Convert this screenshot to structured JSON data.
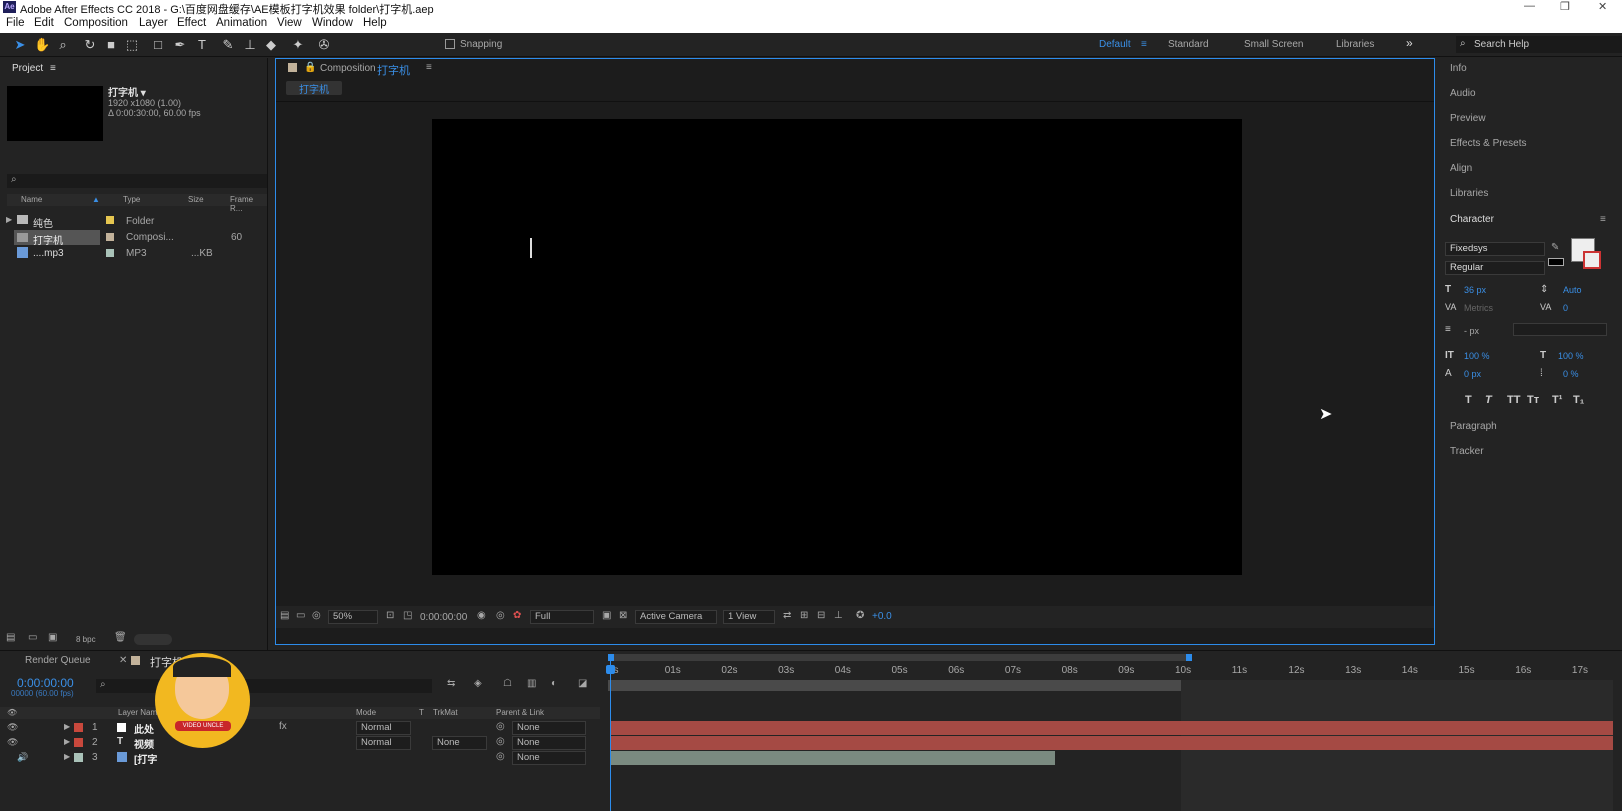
{
  "app": {
    "logo": "Ae",
    "title": "Adobe After Effects CC 2018 - G:\\百度网盘缓存\\AE模板打字机效果 folder\\打字机.aep"
  },
  "menu": [
    "File",
    "Edit",
    "Composition",
    "Layer",
    "Effect",
    "Animation",
    "View",
    "Window",
    "Help"
  ],
  "toolbar": {
    "snapping": "Snapping",
    "workspaces": [
      "Default",
      "Standard",
      "Small Screen",
      "Libraries"
    ],
    "more": "»",
    "search": "Search Help"
  },
  "project": {
    "title": "Project",
    "comp_name": "打字机 ▾",
    "comp_info1": "1920 x1080 (1.00)",
    "comp_info2": "Δ 0:00:30:00, 60.00 fps",
    "cols": [
      "Name",
      "Type",
      "Size",
      "Frame R..."
    ],
    "items": [
      {
        "name": "纯色",
        "type": "Folder",
        "size": "",
        "fr": ""
      },
      {
        "name": "打字机",
        "type": "Composi...",
        "size": "",
        "fr": "60"
      },
      {
        "name": "....mp3",
        "type": "MP3",
        "size": "...KB",
        "fr": ""
      }
    ],
    "bpc": "8 bpc"
  },
  "comp": {
    "tab_label": "Composition",
    "tab_name": "打字机",
    "subtab": "打字机",
    "zoom": "50%",
    "time": "0:00:00:00",
    "res": "Full",
    "camera": "Active Camera",
    "views": "1 View",
    "exposure": "+0.0"
  },
  "right": {
    "panels": [
      "Info",
      "Audio",
      "Preview",
      "Effects & Presets",
      "Align",
      "Libraries"
    ],
    "character": "Character",
    "font": "Fixedsys",
    "style": "Regular",
    "size": "36 px",
    "leading": "Auto",
    "kerning": "Metrics",
    "tracking": "0",
    "stroke": "- px",
    "vscale": "100 %",
    "hscale": "100 %",
    "baseline": "0 px",
    "tsume": "0 %",
    "styles": [
      "T",
      "T",
      "TT",
      "Tт",
      "T¹",
      "T₁"
    ],
    "bottom": [
      "Paragraph",
      "Tracker"
    ]
  },
  "timeline": {
    "tabs": [
      "Render Queue",
      "打字机"
    ],
    "time": "0:00:00:00",
    "frames": "00000 (60.00 fps)",
    "headers": {
      "layer": "Layer Name",
      "mode": "Mode",
      "t": "T",
      "trkmat": "TrkMat",
      "parent": "Parent & Link"
    },
    "layers": [
      {
        "num": "1",
        "name": "此处",
        "mode": "Normal",
        "trk": "",
        "parent": "None"
      },
      {
        "num": "2",
        "name": "视频",
        "mode": "Normal",
        "trk": "None",
        "parent": "None"
      },
      {
        "num": "3",
        "name": "[打字",
        "mode": "",
        "trk": "",
        "parent": "None"
      }
    ],
    "ruler": [
      "0s",
      "01s",
      "02s",
      "03s",
      "04s",
      "05s",
      "06s",
      "07s",
      "08s",
      "09s",
      "10s",
      "11s",
      "12s",
      "13s",
      "14s",
      "15s",
      "16s",
      "17s"
    ],
    "avatar": "VIDEO UNCLE"
  }
}
